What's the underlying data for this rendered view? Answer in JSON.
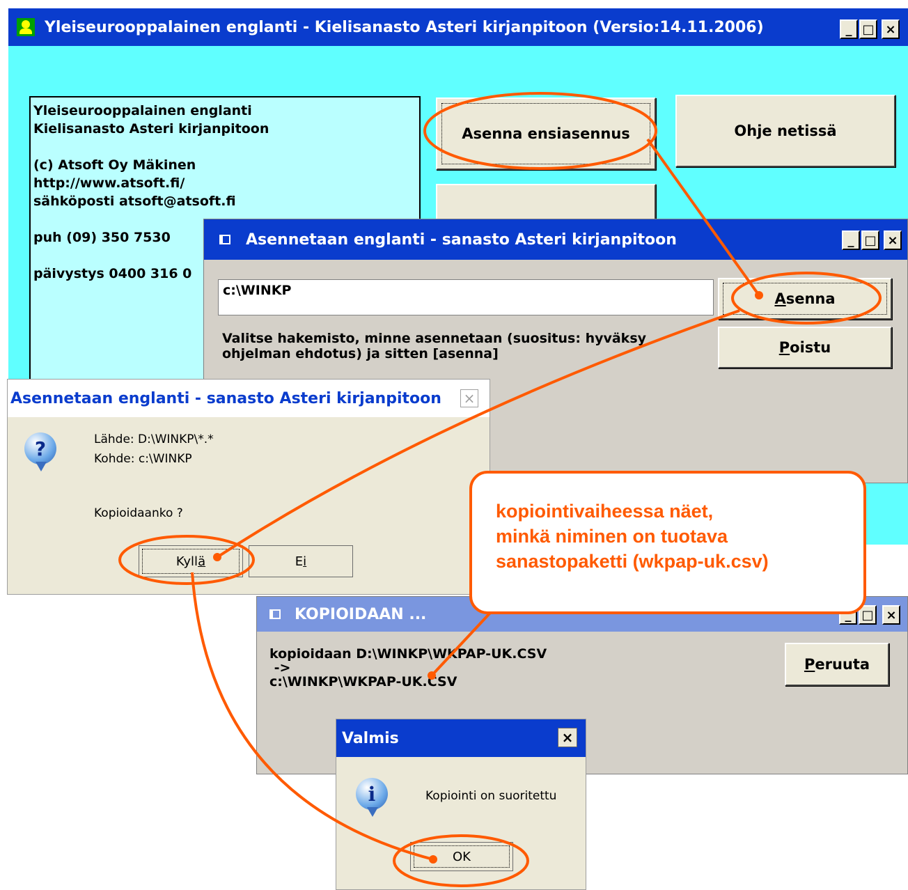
{
  "main_window": {
    "title": "Yleiseurooppalainen englanti - Kielisanasto Asteri kirjanpitoon (Versio:14.11.2006)",
    "info_lines": [
      "Yleiseurooppalainen englanti",
      "Kielisanasto Asteri kirjanpitoon",
      "",
      "(c) Atsoft Oy Mäkinen",
      "http://www.atsoft.fi/",
      "sähköposti atsoft@atsoft.fi",
      "",
      "puh (09) 350 7530",
      "",
      "päivystys 0400 316 0"
    ],
    "install_button": "Asenna ensiasennus",
    "help_button": "Ohje netissä",
    "window_buttons": {
      "minimize": "_",
      "maximize": "□",
      "close": "×"
    },
    "colors": {
      "titlebar": "#0a3ccd",
      "client": "#60ffff",
      "info_box": "#baffff"
    }
  },
  "install_dialog": {
    "title": "Asennetaan englanti - sanasto Asteri kirjanpitoon",
    "path_value": "c:\\WINKP",
    "install_button": {
      "mnemonic": "A",
      "rest": "senna"
    },
    "exit_button": {
      "mnemonic": "P",
      "rest": "oistu"
    },
    "instruction_lines": [
      "Valitse hakemisto, minne asennetaan (suositus: hyväksy",
      "ohjelman ehdotus) ja sitten [asenna]"
    ]
  },
  "confirm_dialog": {
    "title": "Asennetaan englanti - sanasto Asteri kirjanpitoon",
    "source": "Lähde: D:\\WINKP\\*.*",
    "target": "Kohde: c:\\WINKP",
    "question": "Kopioidaanko ?",
    "yes_button": {
      "before": "Kyll",
      "mnemonic": "ä"
    },
    "no_button": {
      "before": "E",
      "mnemonic": "i"
    }
  },
  "copy_window": {
    "title": "KOPIOIDAAN ...",
    "lines": [
      "kopioidaan D:\\WINKP\\WKPAP-UK.CSV",
      " ->",
      "c:\\WINKP\\WKPAP-UK.CSV"
    ],
    "cancel_button": {
      "mnemonic": "P",
      "rest": "eruuta"
    }
  },
  "done_dialog": {
    "title": "Valmis",
    "message": "Kopiointi on suoritettu",
    "ok_button": "OK"
  },
  "callout": {
    "lines": [
      "kopiointivaiheessa näet,",
      "minkä niminen on tuotava",
      "sanastopaketti (wkpap-uk.csv)"
    ],
    "color": "#ff5a00"
  },
  "icons": {
    "app": "app-icon",
    "question": "question-icon",
    "info": "info-icon"
  }
}
